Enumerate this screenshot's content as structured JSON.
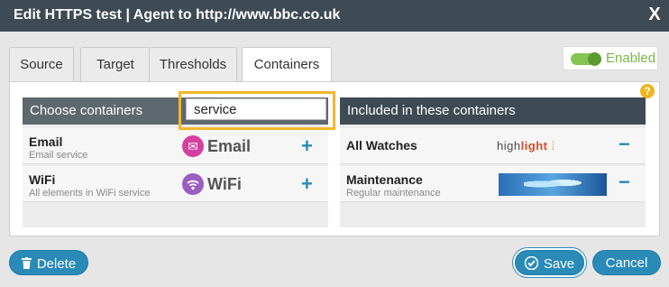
{
  "dialog": {
    "title": "Edit HTTPS test | Agent to http://www.bbc.co.uk",
    "close_label": "X"
  },
  "tabs": [
    {
      "label": "Source",
      "active": false
    },
    {
      "label": "Target",
      "active": false
    },
    {
      "label": "Thresholds",
      "active": false
    },
    {
      "label": "Containers",
      "active": true
    }
  ],
  "toggle": {
    "label": "Enabled",
    "on": true
  },
  "help": {
    "label": "?"
  },
  "choose": {
    "header": "Choose containers",
    "search_value": "service",
    "items": [
      {
        "name": "Email",
        "description": "Email service",
        "logo_text": "Email",
        "logo_icon": "envelope-icon",
        "action": "+"
      },
      {
        "name": "WiFi",
        "description": "All elements in WiFi service",
        "logo_text": "WiFi",
        "logo_icon": "wifi-icon",
        "action": "+"
      }
    ]
  },
  "included": {
    "header": "Included in these containers",
    "items": [
      {
        "name": "All Watches",
        "description": "",
        "logo_text": "highlight",
        "action": "−"
      },
      {
        "name": "Maintenance",
        "description": "Regular maintenance",
        "logo_text": "",
        "action": "−"
      }
    ]
  },
  "buttons": {
    "delete": {
      "label": "Delete",
      "icon": "trash-icon"
    },
    "save": {
      "label": "Save",
      "icon": "check-icon"
    },
    "cancel": {
      "label": "Cancel"
    }
  },
  "colors": {
    "titlebar": "#3e4a54",
    "accent": "#2a8ab8",
    "search_highlight": "#f2b82b",
    "enabled": "#7ab648"
  }
}
